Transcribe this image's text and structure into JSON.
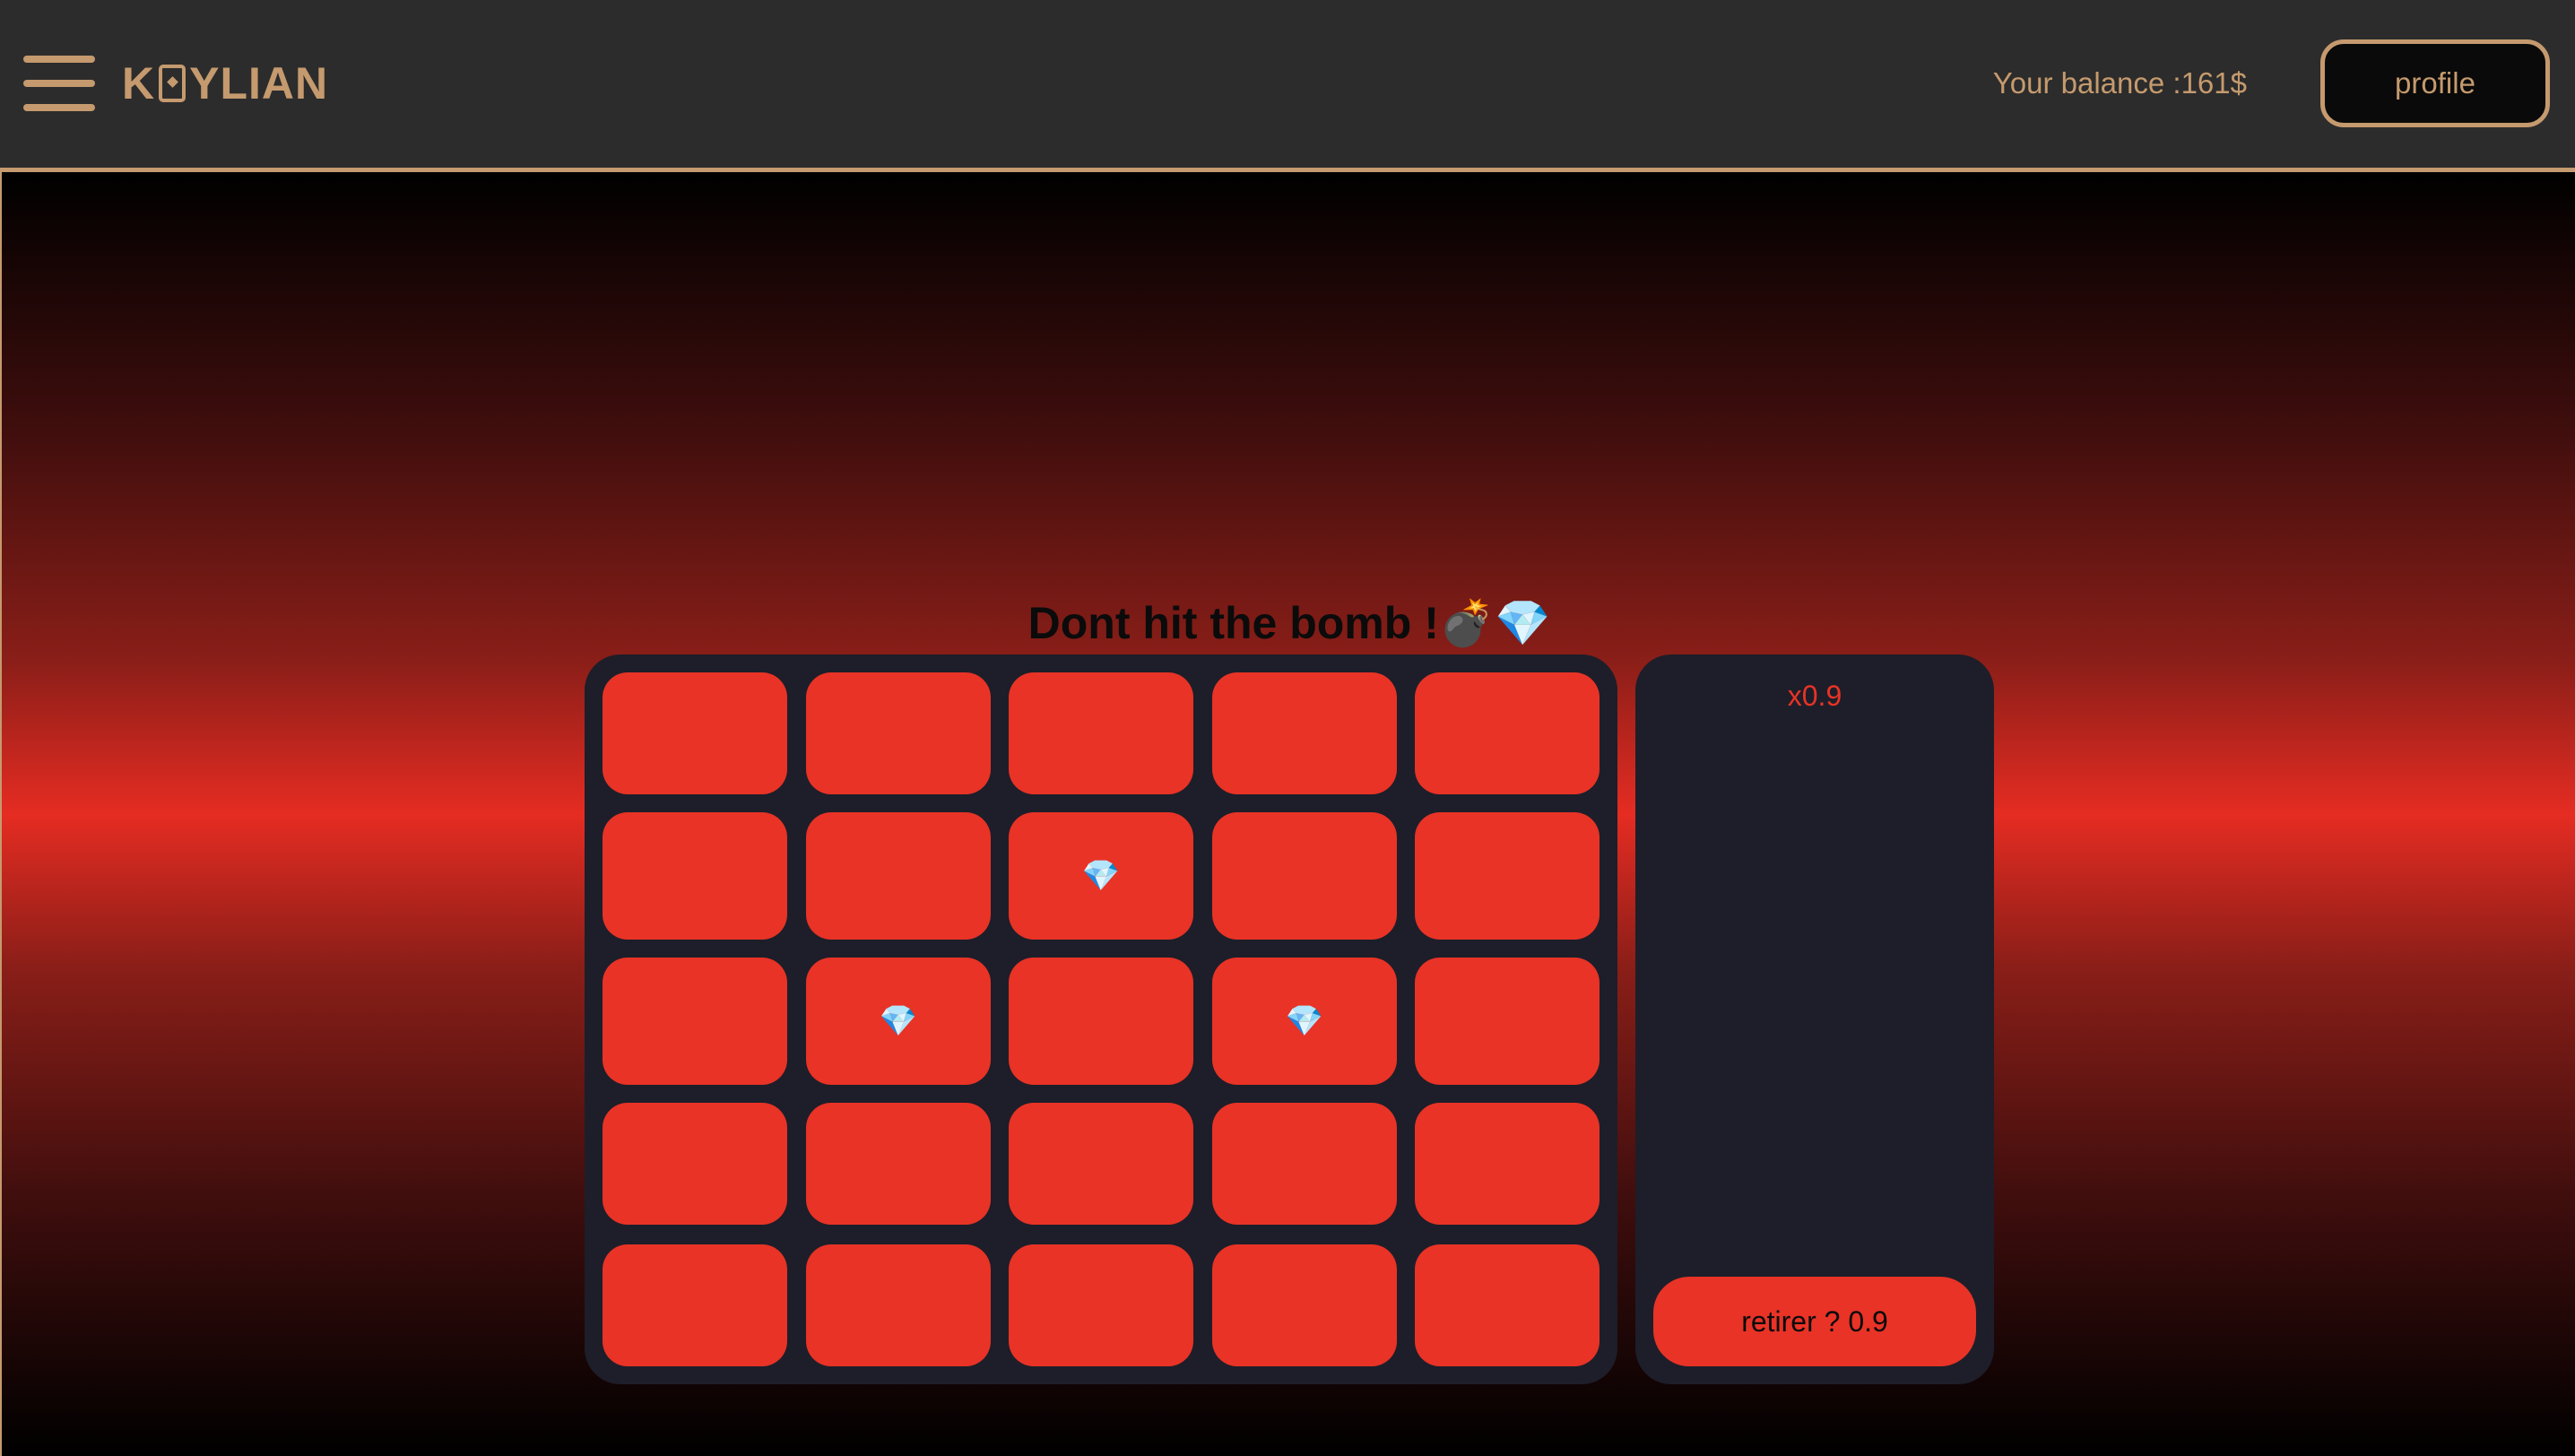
{
  "header": {
    "logo_text": "K♠YLIAN",
    "logo_prefix": "K",
    "logo_suffix": "YLIAN",
    "balance_text": "Your balance :161$",
    "profile_label": "profile",
    "menu_icon": "hamburger-menu-icon"
  },
  "game": {
    "title": "Dont hit the bomb !💣💎",
    "grid": [
      [
        "",
        "",
        "",
        "",
        ""
      ],
      [
        "",
        "",
        "💎",
        "",
        ""
      ],
      [
        "",
        "💎",
        "",
        "💎",
        ""
      ],
      [
        "",
        "",
        "",
        "",
        ""
      ],
      [
        "",
        "",
        "",
        "",
        ""
      ]
    ],
    "multiplier": "x0.9",
    "cashout_label": "retirer ? 0.9"
  },
  "colors": {
    "accent": "#c59a6e",
    "tile": "#e83326",
    "panel": "#1d1e29",
    "navbar": "#2c2c2c"
  }
}
